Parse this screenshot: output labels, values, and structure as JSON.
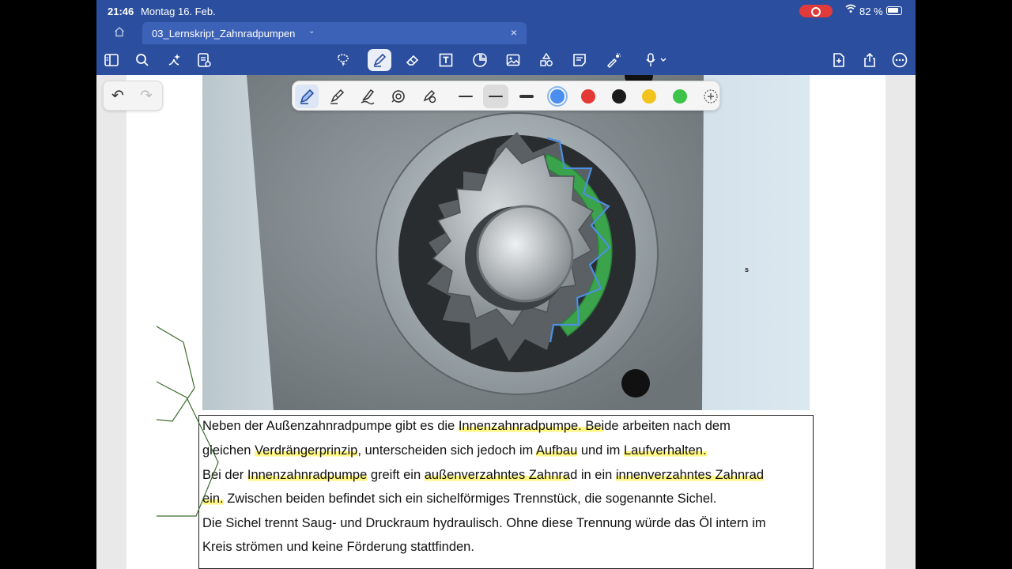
{
  "status_bar": {
    "time": "21:46",
    "date": "Montag 16. Feb.",
    "battery": "82 %"
  },
  "tab": {
    "title": "03_Lernskript_Zahnradpumpen"
  },
  "toolbar": {
    "left_icons": [
      "sidebar-icon",
      "search-icon",
      "ai-sparkle-icon",
      "page-list-icon"
    ],
    "center_icons": [
      "lasso-icon",
      "pen-icon",
      "eraser-icon",
      "textbox-icon",
      "sticker-icon",
      "image-icon",
      "shapes-icon",
      "note-icon",
      "laser-icon",
      "mic-icon"
    ],
    "right_icons": [
      "add-page-icon",
      "share-icon",
      "more-icon"
    ]
  },
  "pen_toolbar": {
    "tools": [
      "fountain-pen-icon",
      "ball-pen-icon",
      "brush-pen-icon",
      "shape-pen-icon",
      "settings-pen-icon"
    ],
    "stroke_sizes": [
      "thin",
      "medium",
      "thick"
    ],
    "selected_stroke": "medium",
    "colors": [
      "#4a8ef0",
      "#e53935",
      "#1c1c1c",
      "#f2c31b",
      "#3cc44a"
    ],
    "selected_color": "#4a8ef0"
  },
  "figure": {
    "marker_text": "s"
  },
  "text": {
    "line1_a": "Neben der Außenzahnradpumpe gibt es die ",
    "line1_hl": "Innenzahnradpumpe. Bei",
    "line1_b": "de arbeiten nach dem",
    "line2_a": "gleichen ",
    "line2_hl1": "Verdrängerprinzip",
    "line2_b": ", unterscheiden sich jedoch im ",
    "line2_hl2": "Aufbau",
    "line2_c": " und im ",
    "line2_hl3": "Laufverhalten.",
    "line3_a": "Bei der ",
    "line3_hl1": "Innenzahnradpumpe",
    "line3_b": " greift ein ",
    "line3_hl2": "außenverzahntes Zahnra",
    "line3_c": "d in ein ",
    "line3_hl3": "innenverzahntes Zahnrad",
    "line4_hl": "ein.",
    "line4_a": " Zwischen beiden befindet sich ein sichelförmiges Trennstück, die sogenannte Sichel.",
    "line5": "Die Sichel trennt Saug- und Druckraum hydraulisch. Ohne diese Trennung würde das Öl intern im",
    "line6": "Kreis strömen und keine Förderung stattfinden."
  },
  "colors": {
    "header_blue": "#2b4f9e",
    "tab_blue": "#3c62b8",
    "highlight_yellow": "#fff35a"
  }
}
